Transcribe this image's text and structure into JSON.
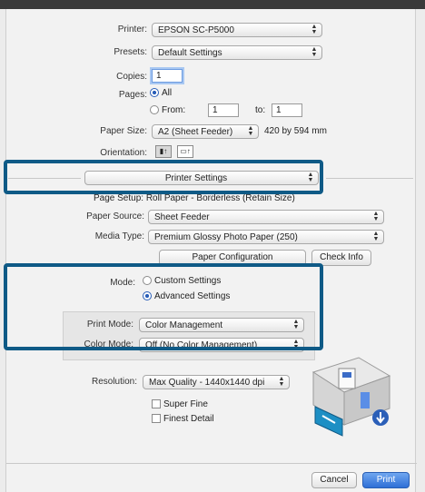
{
  "printer": {
    "label": "Printer:",
    "value": "EPSON SC-P5000"
  },
  "presets": {
    "label": "Presets:",
    "value": "Default Settings"
  },
  "copies": {
    "label": "Copies:",
    "value": "1"
  },
  "pages": {
    "label": "Pages:",
    "all_label": "All",
    "from_label": "From:",
    "from_value": "1",
    "to_label": "to:",
    "to_value": "1"
  },
  "paper_size": {
    "label": "Paper Size:",
    "value": "A2 (Sheet Feeder)",
    "dims": "420 by 594 mm"
  },
  "orientation": {
    "label": "Orientation:",
    "portrait_glyph": "▮↑",
    "landscape_glyph": "▭↑"
  },
  "panel_select": {
    "value": "Printer Settings"
  },
  "page_setup": {
    "text": "Page Setup: Roll Paper - Borderless (Retain Size)"
  },
  "paper_source": {
    "label": "Paper Source:",
    "value": "Sheet Feeder"
  },
  "media_type": {
    "label": "Media Type:",
    "value": "Premium Glossy Photo Paper (250)"
  },
  "paper_config": {
    "text": "Paper Configuration",
    "button_label": "Check Info"
  },
  "mode": {
    "label": "Mode:",
    "option1": "Custom Settings",
    "option2": "Advanced Settings"
  },
  "print_mode": {
    "label": "Print Mode:",
    "value": "Color Management"
  },
  "color_mode": {
    "label": "Color Mode:",
    "value": "Off (No Color Management)"
  },
  "resolution": {
    "label": "Resolution:",
    "value": "Max Quality - 1440x1440 dpi"
  },
  "super_fine": {
    "label": "Super Fine"
  },
  "finest_detail": {
    "label": "Finest Detail"
  },
  "footer": {
    "cancel_label": "Cancel",
    "print_label": "Print"
  }
}
